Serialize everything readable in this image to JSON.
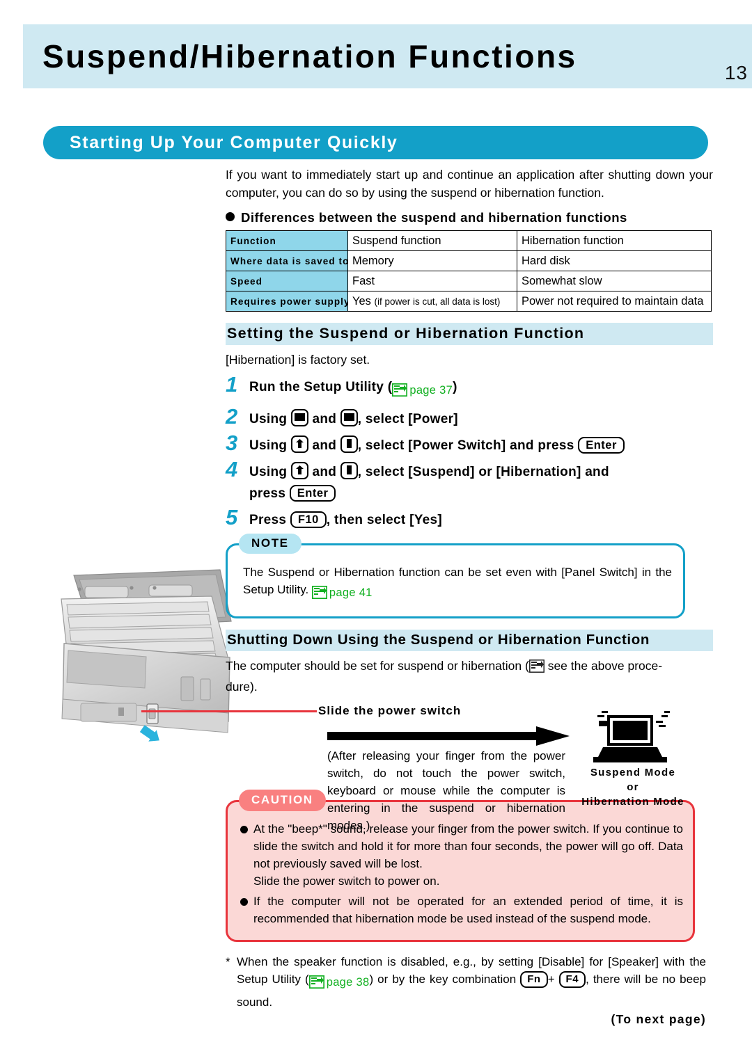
{
  "header": {
    "title": "Suspend/Hibernation Functions",
    "page_number": "13"
  },
  "section": {
    "banner_label": "Starting Up Your Computer Quickly",
    "intro": "If you want to immediately start up and continue an application after shutting down your computer, you can do so by using the suspend or hibernation function.",
    "bullet_heading": "Differences between the suspend and hibernation functions"
  },
  "comparison_table": {
    "rows": [
      {
        "head": "Function",
        "suspend": "Suspend function",
        "hibernation": "Hibernation function"
      },
      {
        "head": "Where data is saved to",
        "suspend": "Memory",
        "hibernation": "Hard disk"
      },
      {
        "head": "Speed",
        "suspend": "Fast",
        "hibernation": "Somewhat slow"
      },
      {
        "head": "Requires power supply",
        "suspend": "Yes",
        "suspend_note": "(if power is cut, all data is lost)",
        "hibernation": "Power not required to maintain data"
      }
    ]
  },
  "setting_section": {
    "heading": "Setting the Suspend or Hibernation Function",
    "factory_note": "[Hibernation] is factory set.",
    "steps": [
      {
        "number": "1",
        "text_before": "Run the Setup Utility (",
        "ref_page": "page 37",
        "text_after": ")"
      },
      {
        "number": "2",
        "lead": "Using",
        "key1": "left-arrow-key",
        "mid": "and",
        "key2": "right-arrow-key",
        "tail": ", select [Power]"
      },
      {
        "number": "3",
        "lead": "Using",
        "key1": "up-arrow-key",
        "mid": "and",
        "key2": "down-arrow-key",
        "tail": ", select [Power Switch] and press",
        "enter_key": "Enter"
      },
      {
        "number": "4",
        "lead": "Using",
        "key1": "up-arrow-key",
        "mid": "and",
        "key2": "down-arrow-key",
        "tail": ", select [Suspend] or [Hibernation] and",
        "line2_lead": "press",
        "enter_key": "Enter"
      },
      {
        "number": "5",
        "lead": "Press",
        "f10_key": "F10",
        "tail": ", then select [Yes]"
      }
    ]
  },
  "note_box": {
    "tab_label": "NOTE",
    "text": "The Suspend or Hibernation function can be set even with [Panel Switch] in the Setup Utility.",
    "ref_page": "page 41"
  },
  "shutdown_section": {
    "heading": "Shutting Down Using the Suspend or Hibernation Function",
    "text_before": "The computer should be set for suspend or hibernation (",
    "text_after": "see the above proce-",
    "text_line2": "dure)."
  },
  "diagram": {
    "label": "Slide the power switch",
    "note": "(After releasing your finger from the power switch, do not touch the power switch, keyboard or mouse while the computer is entering in the suspend or hibernation modes.)",
    "mode_caption_line1": "Suspend Mode",
    "mode_caption_line2": "or",
    "mode_caption_line3": "Hibernation Mode"
  },
  "caution_box": {
    "tab_label": "CAUTION",
    "items": [
      "At the \"beep*\" sound, release your finger from the power switch.  If you continue to slide the switch and hold it for more than four seconds, the power will go off.  Data not previously saved will be lost.\nSlide the power switch to power on.",
      "If the computer will not be operated for an extended period of time, it is recommended that hibernation mode be used instead of the suspend mode."
    ]
  },
  "footnote": {
    "marker": "*",
    "text_part1": "When the speaker function is disabled, e.g., by setting [Disable] for [Speaker] with the Setup Utility (",
    "ref_page": "page 38",
    "text_part2": ") or by the key combination",
    "key_fn": "Fn",
    "plus": "+",
    "key_f4": "F4",
    "text_part3": ", there will be no beep sound.",
    "to_next_page": "(To next page)"
  },
  "colors": {
    "header_band": "#cfe9f2",
    "accent_blue": "#13a0c8",
    "table_head": "#8fd6ea",
    "caution_border": "#e8343c",
    "caution_fill": "#fbd8d6",
    "caution_tab": "#f98080",
    "ref_green": "#12b021"
  }
}
